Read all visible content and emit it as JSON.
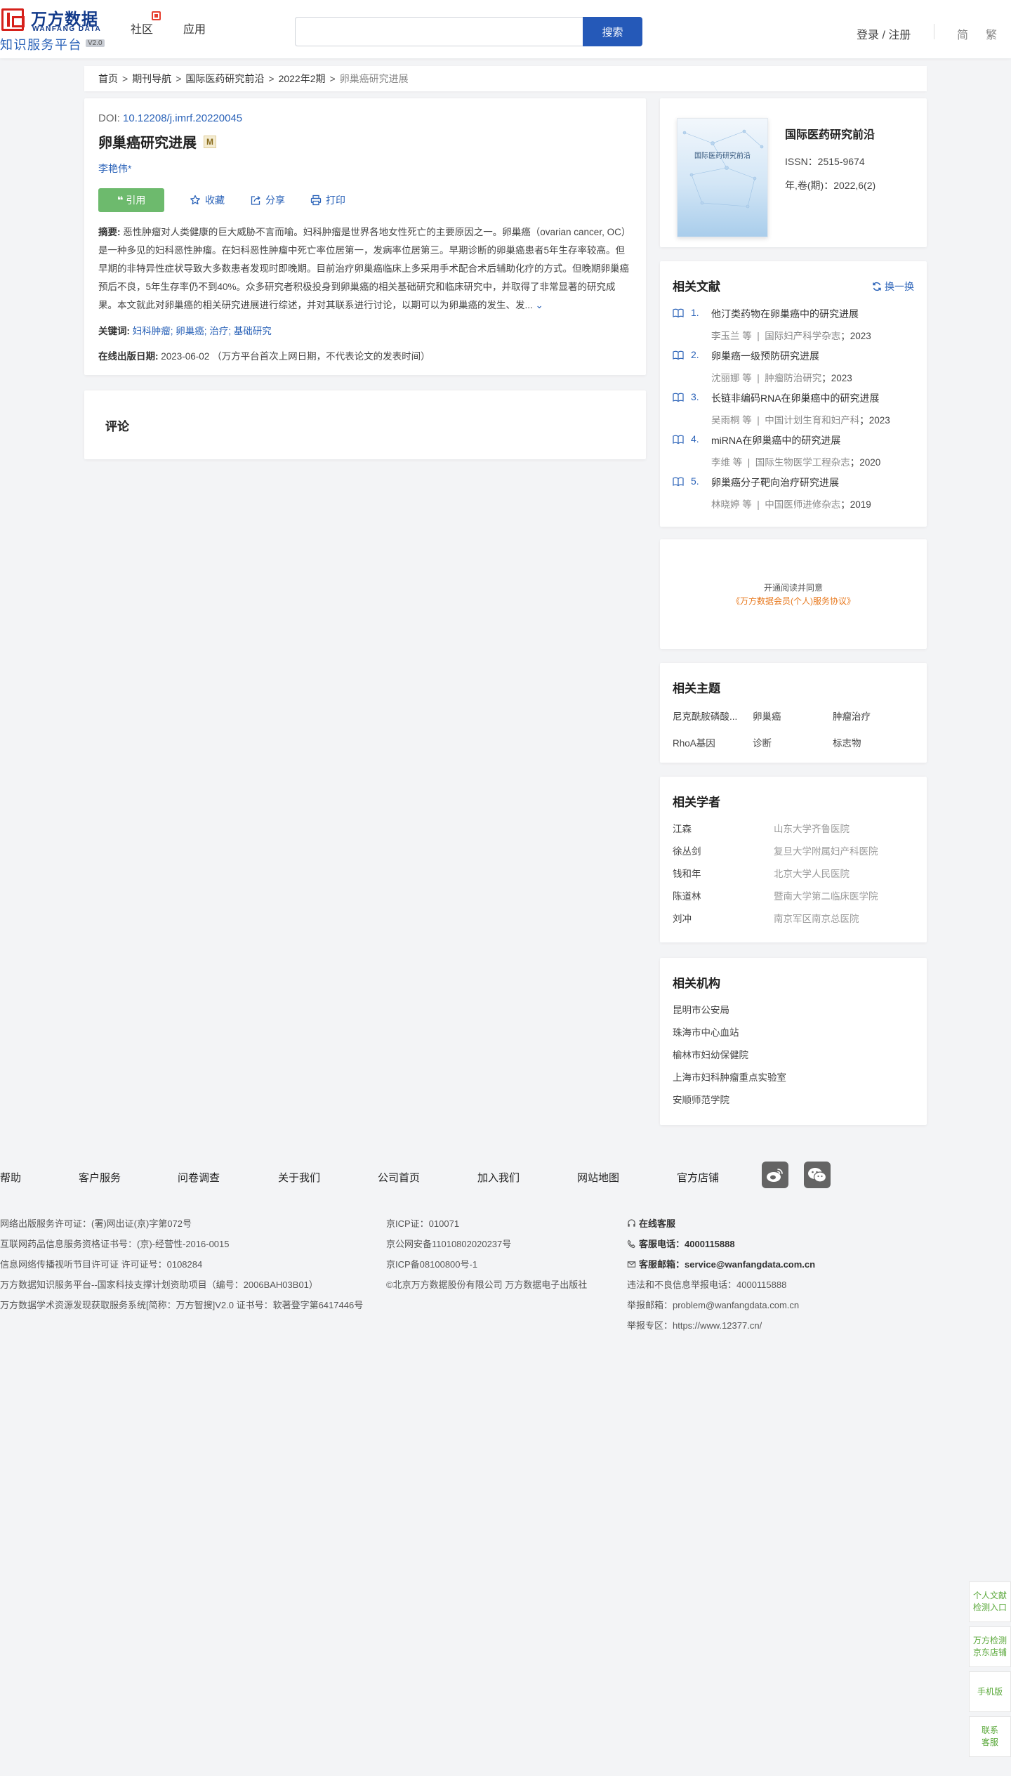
{
  "header": {
    "logo_cn": "万方数据",
    "logo_en": "WANFANG DATA",
    "logo_sub": "知识服务平台",
    "logo_version": "V2.0",
    "nav": [
      "社区",
      "应用"
    ],
    "search_placeholder": "",
    "search_button": "搜索",
    "login": "登录 / 注册",
    "lang_simplified": "简",
    "lang_traditional": "繁"
  },
  "breadcrumb": [
    "首页",
    "期刊导航",
    "国际医药研究前沿",
    "2022年2期",
    "卵巢癌研究进展"
  ],
  "article": {
    "doi_label": "DOI:",
    "doi": "10.12208/j.imrf.20220045",
    "title": "卵巢癌研究进展",
    "badge": "M",
    "author": "李艳伟*",
    "actions": {
      "cite": "引用",
      "favorite": "收藏",
      "share": "分享",
      "print": "打印"
    },
    "abstract_label": "摘要:",
    "abstract": "恶性肿瘤对人类健康的巨大威胁不言而喻。妇科肿瘤是世界各地女性死亡的主要原因之一。卵巢癌（ovarian cancer, OC）是一种多见的妇科恶性肿瘤。在妇科恶性肿瘤中死亡率位居第一，发病率位居第三。早期诊断的卵巢癌患者5年生存率较高。但早期的非特异性症状导致大多数患者发现时即晚期。目前治疗卵巢癌临床上多采用手术配合术后辅助化疗的方式。但晚期卵巢癌预后不良，5年生存率仍不到40%。众多研究者积极投身到卵巢癌的相关基础研究和临床研究中，并取得了非常显著的研究成果。本文就此对卵巢癌的相关研究进展进行综述，并对其联系进行讨论，以期可以为卵巢癌的发生、发...",
    "keywords_label": "关键词:",
    "keywords": "妇科肿瘤; 卵巢癌; 治疗; 基础研究",
    "date_label": "在线出版日期:",
    "date": "2023-06-02 （万方平台首次上网日期，不代表论文的发表时间）"
  },
  "comment": {
    "title": "评论"
  },
  "journal": {
    "cover_title": "国际医药研究前沿",
    "name": "国际医药研究前沿",
    "issn": "ISSN：2515-9674",
    "volume": "年,卷(期)：2022,6(2)"
  },
  "related_docs": {
    "title": "相关文献",
    "refresh": "换一换",
    "items": [
      {
        "num": "1.",
        "title": "他汀类药物在卵巢癌中的研究进展",
        "authors": "李玉兰 等",
        "source": "国际妇产科学杂志",
        "year": "2023"
      },
      {
        "num": "2.",
        "title": "卵巢癌一级预防研究进展",
        "authors": "沈丽娜 等",
        "source": "肿瘤防治研究",
        "year": "2023"
      },
      {
        "num": "3.",
        "title": "长链非编码RNA在卵巢癌中的研究进展",
        "authors": "吴雨桐 等",
        "source": "中国计划生育和妇产科",
        "year": "2023"
      },
      {
        "num": "4.",
        "title": "miRNA在卵巢癌中的研究进展",
        "authors": "李维 等",
        "source": "国际生物医学工程杂志",
        "year": "2020"
      },
      {
        "num": "5.",
        "title": "卵巢癌分子靶向治疗研究进展",
        "authors": "林晓婷 等",
        "source": "中国医师进修杂志",
        "year": "2019"
      }
    ]
  },
  "promo": {
    "line1": "开通阅读并同意",
    "line2": "《万方数据会员(个人)服务协议》"
  },
  "topics": {
    "title": "相关主题",
    "items": [
      "尼克酰胺磷酸...",
      "卵巢癌",
      "肿瘤治疗",
      "RhoA基因",
      "诊断",
      "标志物"
    ]
  },
  "scholars": {
    "title": "相关学者",
    "items": [
      {
        "name": "江森",
        "org": "山东大学齐鲁医院"
      },
      {
        "name": "徐丛剑",
        "org": "复旦大学附属妇产科医院"
      },
      {
        "name": "钱和年",
        "org": "北京大学人民医院"
      },
      {
        "name": "陈道林",
        "org": "暨南大学第二临床医学院"
      },
      {
        "name": "刘冲",
        "org": "南京军区南京总医院"
      }
    ]
  },
  "institutions": {
    "title": "相关机构",
    "items": [
      "昆明市公安局",
      "珠海市中心血站",
      "榆林市妇幼保健院",
      "上海市妇科肿瘤重点实验室",
      "安顺师范学院"
    ]
  },
  "footer": {
    "links": [
      "帮助",
      "客户服务",
      "问卷调查",
      "关于我们",
      "公司首页",
      "加入我们",
      "网站地图",
      "官方店铺"
    ],
    "col1": [
      "网络出版服务许可证：(署)网出证(京)字第072号",
      "互联网药品信息服务资格证书号：(京)-经营性-2016-0015",
      "信息网络传播视听节目许可证 许可证号：0108284",
      "万方数据知识服务平台--国家科技支撑计划资助项目（编号：2006BAH03B01）",
      "万方数据学术资源发现获取服务系统[简称：万方智搜]V2.0 证书号：软著登字第6417446号"
    ],
    "col2": [
      "京ICP证：010071",
      "京公网安备11010802020237号",
      "京ICP备08100800号-1",
      "©北京万方数据股份有限公司 万方数据电子出版社"
    ],
    "online_service": "在线客服",
    "phone_label": "客服电话：",
    "phone": "4000115888",
    "email_label": "客服邮箱：",
    "email": "service@wanfangdata.com.cn",
    "report_phone": "违法和不良信息举报电话：4000115888",
    "report_email": "举报邮箱：problem@wanfangdata.com.cn",
    "report_zone": "举报专区：https://www.12377.cn/"
  },
  "side_buttons": [
    {
      "line1": "个人文献",
      "line2": "检测入口"
    },
    {
      "line1": "万方检测",
      "line2": "京东店铺"
    },
    {
      "line1": "手机版",
      "line2": ""
    },
    {
      "line1": "联系",
      "line2": "客服"
    }
  ],
  "colors": {
    "brand_blue": "#2559b8",
    "link_blue": "#2a62b8",
    "cite_green": "#6dba6d",
    "logo_red": "#d6201a",
    "promo_orange": "#e8791e"
  }
}
